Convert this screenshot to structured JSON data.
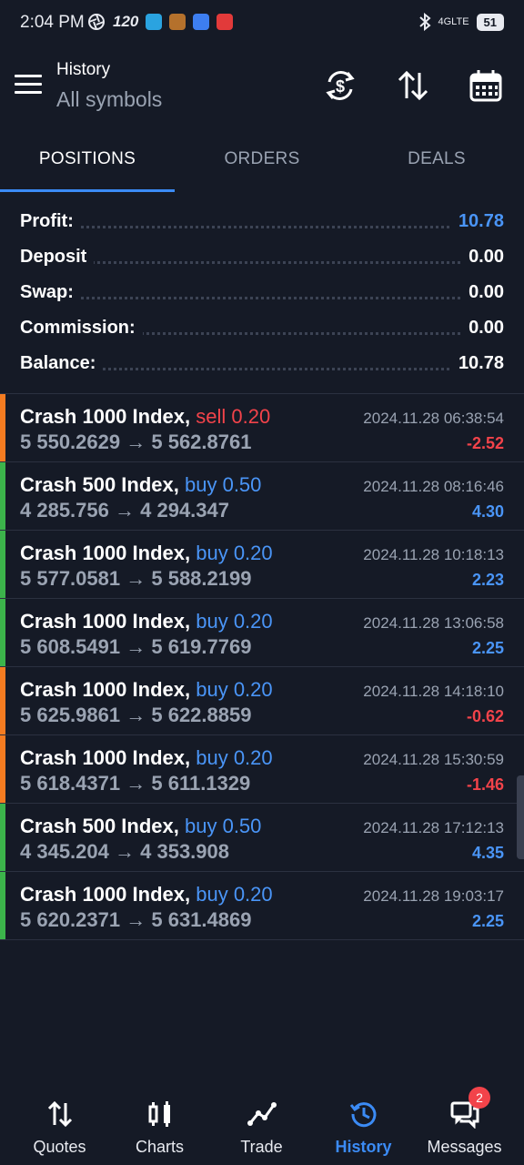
{
  "status_bar": {
    "time": "2:04 PM",
    "refresh_rate": "120",
    "network": "4GLTE",
    "battery": "51"
  },
  "header": {
    "title": "History",
    "subtitle": "All symbols"
  },
  "tabs": [
    {
      "label": "POSITIONS"
    },
    {
      "label": "ORDERS"
    },
    {
      "label": "DEALS"
    }
  ],
  "summary": [
    {
      "label": "Profit:",
      "value": "10.78"
    },
    {
      "label": "Deposit",
      "value": "0.00"
    },
    {
      "label": "Swap:",
      "value": "0.00"
    },
    {
      "label": "Commission:",
      "value": "0.00"
    },
    {
      "label": "Balance:",
      "value": "10.78"
    }
  ],
  "deals": [
    {
      "symbol": "Crash 1000 Index,",
      "side": "sell 0.20",
      "open": "5 550.2629",
      "close": "5 562.8761",
      "time": "2024.11.28 06:38:54",
      "profit": "-2.52"
    },
    {
      "symbol": "Crash 500 Index,",
      "side": "buy 0.50",
      "open": "4 285.756",
      "close": "4 294.347",
      "time": "2024.11.28 08:16:46",
      "profit": "4.30"
    },
    {
      "symbol": "Crash 1000 Index,",
      "side": "buy 0.20",
      "open": "5 577.0581",
      "close": "5 588.2199",
      "time": "2024.11.28 10:18:13",
      "profit": "2.23"
    },
    {
      "symbol": "Crash 1000 Index,",
      "side": "buy 0.20",
      "open": "5 608.5491",
      "close": "5 619.7769",
      "time": "2024.11.28 13:06:58",
      "profit": "2.25"
    },
    {
      "symbol": "Crash 1000 Index,",
      "side": "buy 0.20",
      "open": "5 625.9861",
      "close": "5 622.8859",
      "time": "2024.11.28 14:18:10",
      "profit": "-0.62"
    },
    {
      "symbol": "Crash 1000 Index,",
      "side": "buy 0.20",
      "open": "5 618.4371",
      "close": "5 611.1329",
      "time": "2024.11.28 15:30:59",
      "profit": "-1.46"
    },
    {
      "symbol": "Crash 500 Index,",
      "side": "buy 0.50",
      "open": "4 345.204",
      "close": "4 353.908",
      "time": "2024.11.28 17:12:13",
      "profit": "4.35"
    },
    {
      "symbol": "Crash 1000 Index,",
      "side": "buy 0.20",
      "open": "5 620.2371",
      "close": "5 631.4869",
      "time": "2024.11.28 19:03:17",
      "profit": "2.25"
    }
  ],
  "arrow": "→",
  "bottom_nav": [
    {
      "label": "Quotes",
      "icon": "quotes-icon"
    },
    {
      "label": "Charts",
      "icon": "charts-icon"
    },
    {
      "label": "Trade",
      "icon": "trade-icon"
    },
    {
      "label": "History",
      "icon": "history-icon"
    },
    {
      "label": "Messages",
      "icon": "messages-icon",
      "badge": "2"
    }
  ],
  "colors": {
    "accent": "#3b8bf5",
    "profit": "#4a95f7",
    "loss": "#f2434a",
    "bar_gain": "#3cb44b",
    "bar_loss": "#f57c21",
    "background": "#151a26"
  }
}
